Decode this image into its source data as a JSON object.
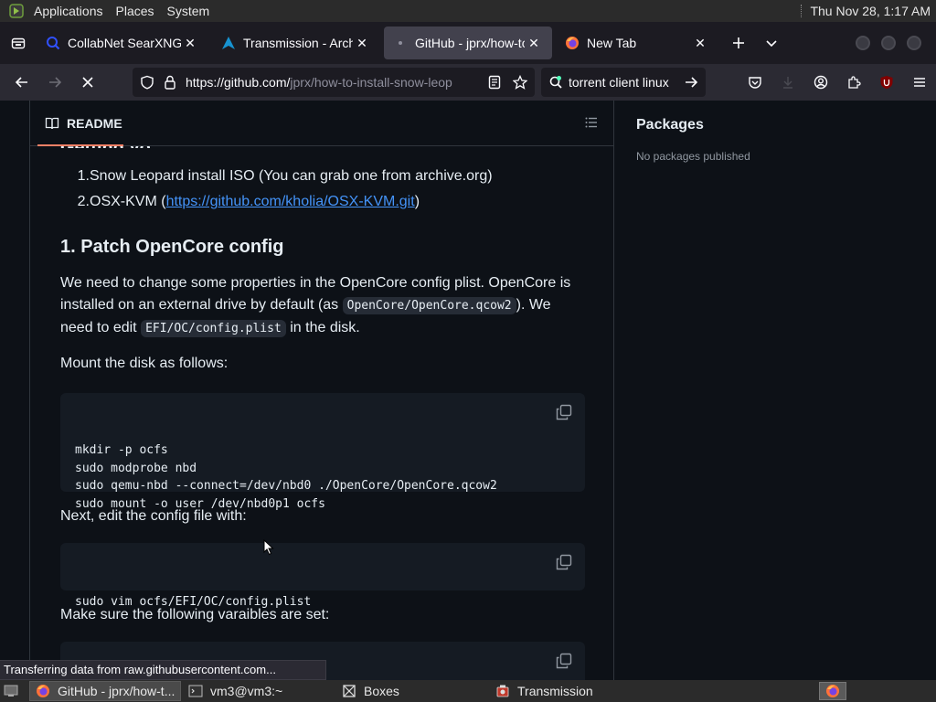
{
  "top_panel": {
    "menus": [
      "Applications",
      "Places",
      "System"
    ],
    "clock": "Thu Nov 28,  1:17 AM"
  },
  "tabs": [
    {
      "label": "CollabNet SearXNG",
      "active": false
    },
    {
      "label": "Transmission - ArchW",
      "active": false
    },
    {
      "label": "GitHub - jprx/how-to-",
      "active": true
    },
    {
      "label": "New Tab",
      "active": false
    }
  ],
  "navbar": {
    "url_host": "https://github.com/",
    "url_rest": "jprx/how-to-install-snow-leop",
    "search_text": "torrent client linux"
  },
  "readme": {
    "header": "README",
    "clipped_heading": "Getting yo",
    "list": [
      {
        "num": "1.",
        "text": "Snow Leopard install ISO (You can grab one from archive.org)"
      },
      {
        "num": "2.",
        "text_before": "OSX-KVM (",
        "link": "https://github.com/kholia/OSX-KVM.git",
        "text_after": ")"
      }
    ],
    "h2": "1. Patch OpenCore config",
    "p1": {
      "a": "We need to change some properties in the OpenCore config plist. OpenCore is installed on an external drive by default (as ",
      "code1": "OpenCore/OpenCore.qcow2",
      "b": "). We need to edit ",
      "code2": "EFI/OC/config.plist",
      "c": " in the disk."
    },
    "p2": "Mount the disk as follows:",
    "code_block_1": "mkdir -p ocfs\nsudo modprobe nbd\nsudo qemu-nbd --connect=/dev/nbd0 ./OpenCore/OpenCore.qcow2\nsudo mount -o user /dev/nbd0p1 ocfs",
    "p3": "Next, edit the config file with:",
    "code_block_2": "sudo vim ocfs/EFI/OC/config.plist",
    "p4": "Make sure the following varaibles are set:"
  },
  "sidebar": {
    "heading": "Packages",
    "sub": "No packages published"
  },
  "status_text": "Transferring data from raw.githubusercontent.com...",
  "taskbar": [
    {
      "label": "GitHub - jprx/how-t...",
      "active": true
    },
    {
      "label": "vm3@vm3:~",
      "active": false
    },
    {
      "label": "Boxes",
      "active": false
    },
    {
      "label": "Transmission",
      "active": false
    }
  ],
  "colors": {
    "link": "#4493f8",
    "accent_underline": "#f78166",
    "page_bg": "#0d1117"
  }
}
